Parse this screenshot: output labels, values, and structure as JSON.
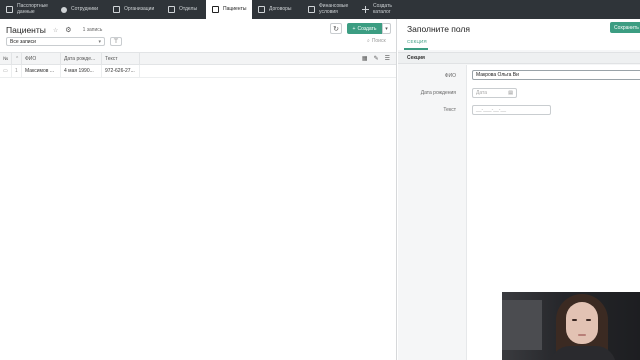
{
  "tabs": [
    {
      "label": "Пасспортные данные",
      "icon": "document-icon",
      "active": false
    },
    {
      "label": "Сотрудники",
      "icon": "users-icon",
      "active": false
    },
    {
      "label": "Организации",
      "icon": "building-icon",
      "active": false
    },
    {
      "label": "Отделы",
      "icon": "document-icon",
      "active": false
    },
    {
      "label": "Пациенты",
      "icon": "document-icon",
      "active": true
    },
    {
      "label": "Договоры",
      "icon": "document-icon",
      "active": false
    },
    {
      "label": "Финансовые условия",
      "icon": "document-icon",
      "active": false
    },
    {
      "label": "Создать каталог",
      "icon": "plus-icon",
      "active": false
    }
  ],
  "list": {
    "title": "Пациенты",
    "count": "1 запись",
    "create_label": "Создать",
    "filter_value": "Все записи",
    "search_placeholder": "Поиск",
    "columns": {
      "num": "№",
      "fio": "ФИО",
      "date": "Дата рожде...",
      "text": "Текст"
    },
    "rows": [
      {
        "idx": "1",
        "fio": "Максимов ...",
        "date": "4 мая 1990...",
        "text": "972-626-27..."
      }
    ]
  },
  "form": {
    "title": "Заполните поля",
    "save_label": "Сохранить",
    "tab_label": "СЕКЦИЯ",
    "section_label": "Секция",
    "fields": {
      "fio_label": "ФИО",
      "fio_value": "Макрова Ольга Ви",
      "date_label": "Дата рождения",
      "date_placeholder": "Дата",
      "text_label": "Текст",
      "text_placeholder": "__-___-__-__"
    }
  },
  "colors": {
    "accent": "#3c9d82",
    "topbar": "#2f3439"
  }
}
